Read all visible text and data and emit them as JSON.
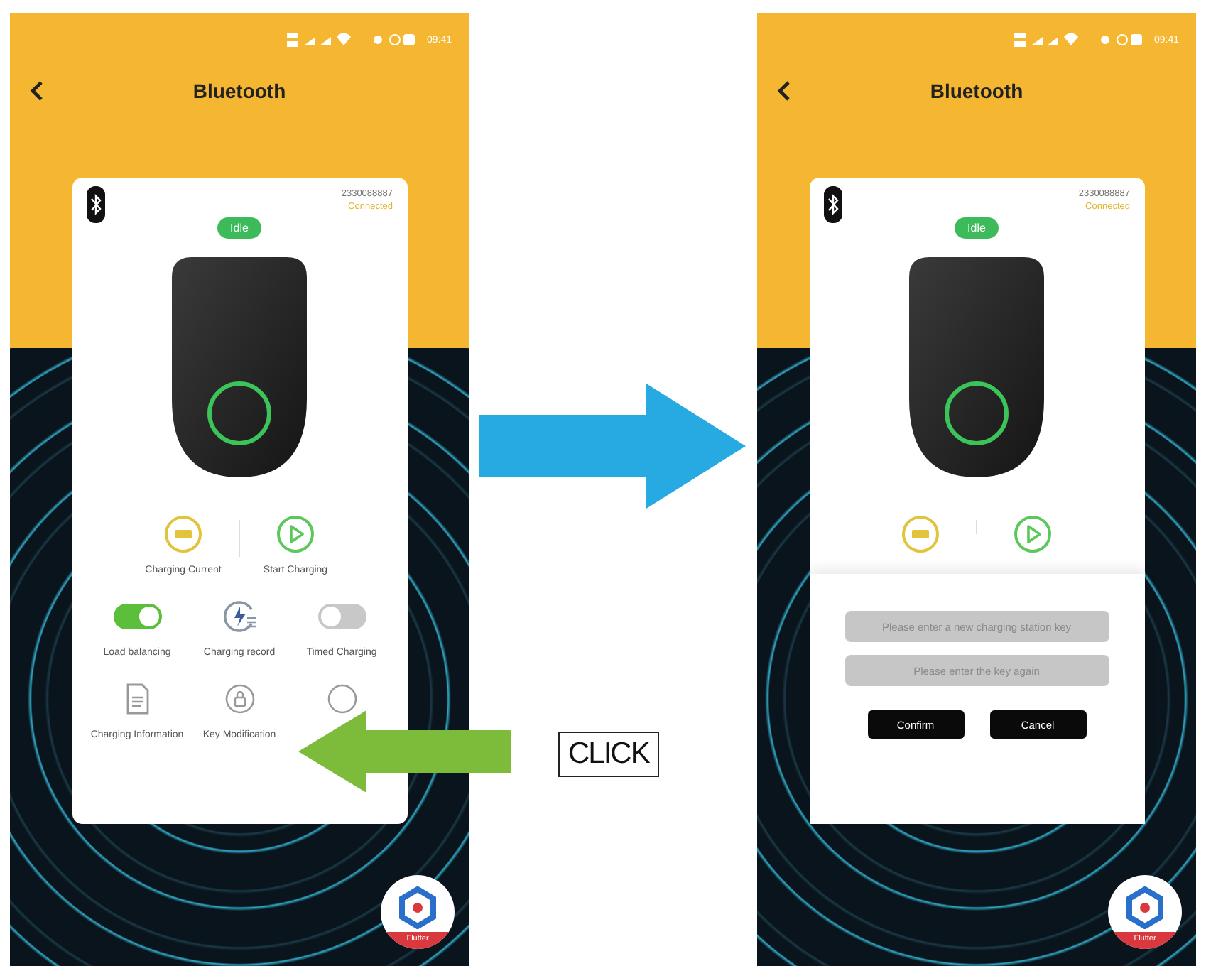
{
  "screens": [
    {
      "status_bar": {
        "time": "09:41"
      },
      "header": {
        "title": "Bluetooth"
      },
      "device": {
        "id": "2330088887",
        "connection": "Connected",
        "status": "Idle"
      },
      "action_rows": [
        [
          {
            "kind": "current",
            "label": "Charging Current"
          },
          {
            "kind": "start",
            "label": "Start Charging"
          }
        ],
        [
          {
            "kind": "toggle",
            "on": true,
            "label": "Load balancing"
          },
          {
            "kind": "record",
            "label": "Charging record"
          },
          {
            "kind": "toggle",
            "on": false,
            "label": "Timed Charging"
          }
        ],
        [
          {
            "kind": "document",
            "label": "Charging Information"
          },
          {
            "kind": "lock",
            "label": "Key Modification"
          },
          {
            "kind": "partial"
          }
        ]
      ],
      "badge": {
        "label": "Flutter"
      }
    },
    {
      "status_bar": {
        "time": "09:41"
      },
      "header": {
        "title": "Bluetooth"
      },
      "device": {
        "id": "2330088887",
        "connection": "Connected",
        "status": "Idle"
      },
      "action_rows": [
        [
          {
            "kind": "current"
          },
          {
            "kind": "start"
          }
        ]
      ],
      "dialog": {
        "fields": [
          {
            "placeholder": "Please enter a new charging station key"
          },
          {
            "placeholder": "Please enter the key again"
          }
        ],
        "buttons": [
          "Confirm",
          "Cancel"
        ]
      },
      "badge": {
        "label": "Flutter"
      }
    }
  ],
  "callout": {
    "label": "CLICK"
  }
}
